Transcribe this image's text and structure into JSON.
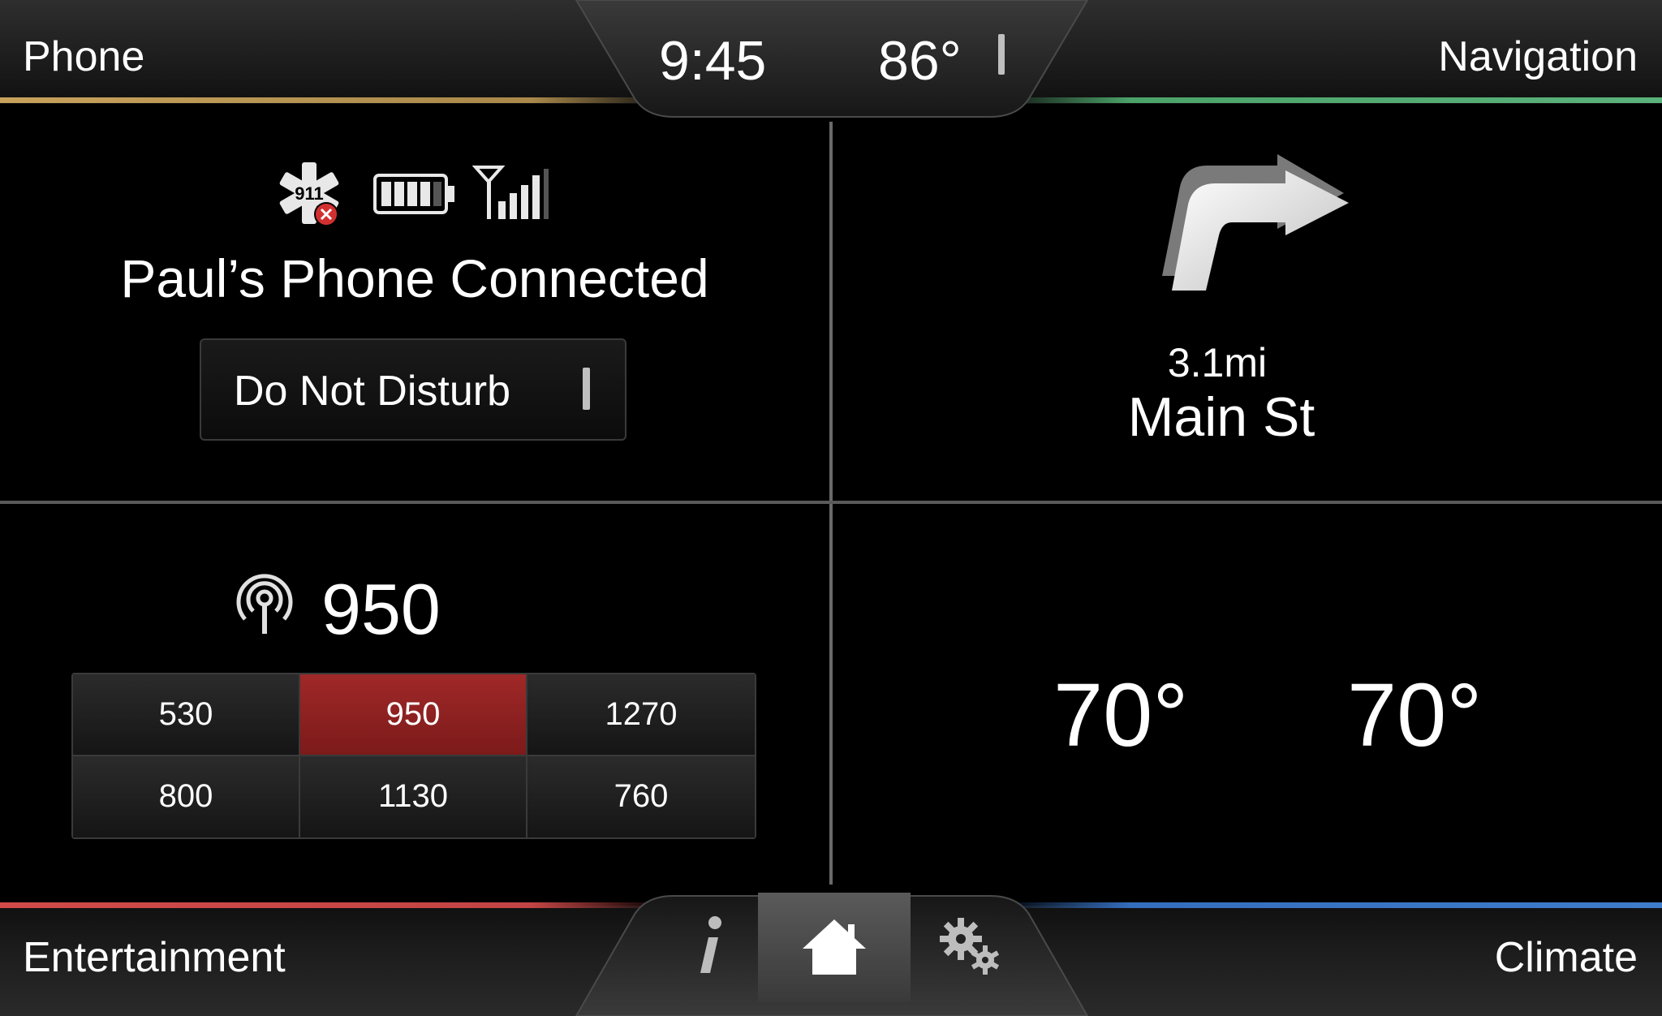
{
  "header": {
    "left_label": "Phone",
    "right_label": "Navigation",
    "time": "9:45",
    "outside_temp": "86°"
  },
  "footer": {
    "left_label": "Entertainment",
    "right_label": "Climate",
    "buttons": [
      {
        "name": "info",
        "icon": "info-icon"
      },
      {
        "name": "home",
        "icon": "home-icon",
        "selected": true
      },
      {
        "name": "settings",
        "icon": "gears-icon"
      }
    ]
  },
  "phone": {
    "emergency_badge": "911",
    "status_text": "Paul’s Phone Connected",
    "dnd_label": "Do Not Disturb",
    "icons": [
      "911-assist-icon",
      "battery-icon",
      "signal-strength-icon"
    ]
  },
  "navigation": {
    "direction": "right-turn-arrow-icon",
    "distance": "3.1mi",
    "street": "Main St"
  },
  "entertainment": {
    "current_frequency": "950",
    "presets": [
      "530",
      "950",
      "1270",
      "800",
      "1130",
      "760"
    ],
    "active_preset": "950"
  },
  "climate": {
    "driver_temp": "70°",
    "passenger_temp": "70°"
  },
  "colors": {
    "phone_accent": "#c8a25c",
    "navigation_accent": "#4ca36a",
    "entertainment_accent": "#d24a4a",
    "climate_accent": "#346ebe",
    "active_preset": "#a02828"
  }
}
